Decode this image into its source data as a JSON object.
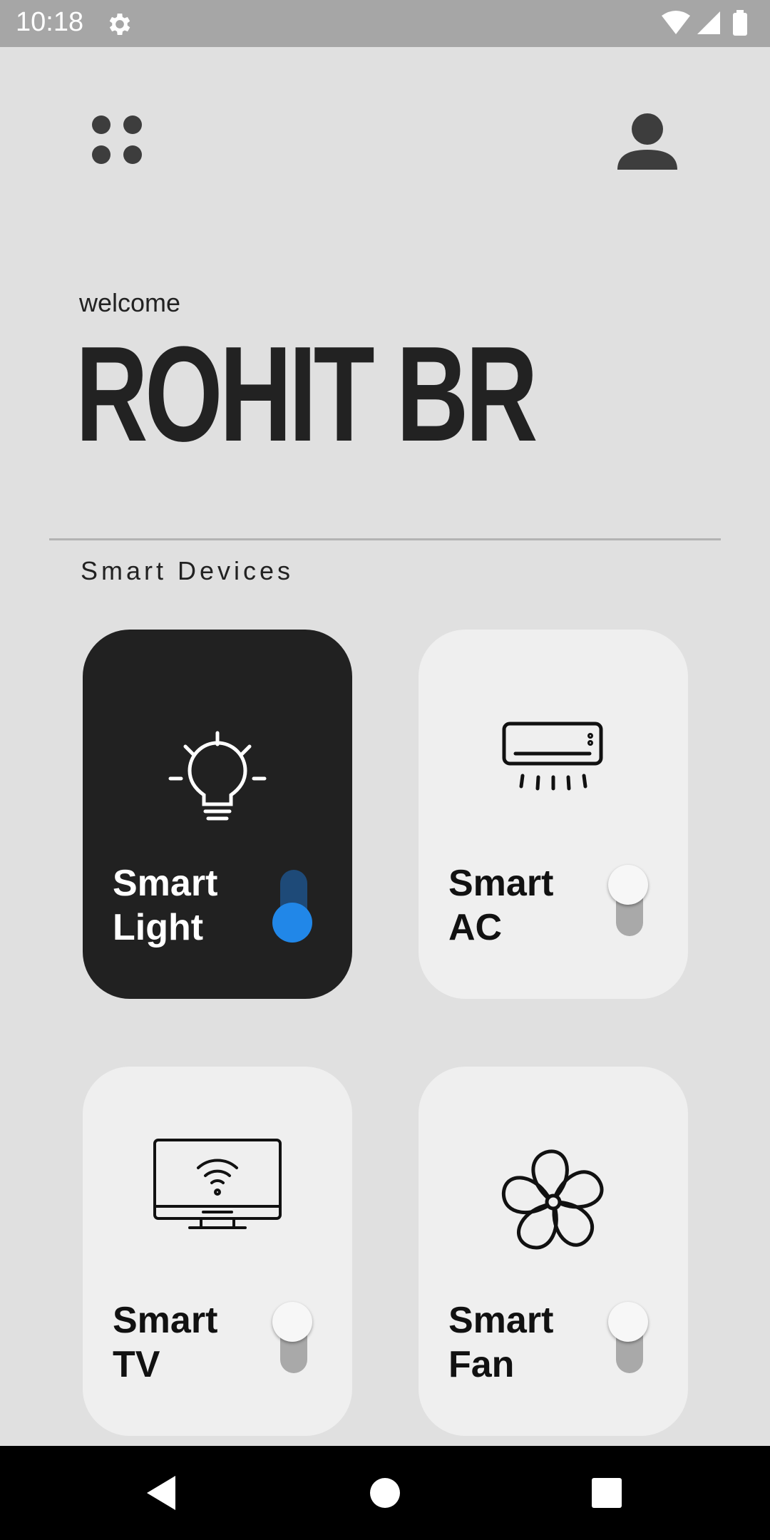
{
  "status_bar": {
    "time": "10:18",
    "icons": [
      "settings-icon",
      "wifi-icon",
      "signal-icon",
      "battery-icon"
    ]
  },
  "header": {
    "menu_icon": "grid-dots-icon",
    "profile_icon": "person-icon"
  },
  "welcome": {
    "label": "welcome",
    "name": "ROHIT BR"
  },
  "section": {
    "title": "Smart Devices"
  },
  "devices": [
    {
      "line1": "Smart",
      "line2": "Light",
      "icon": "light-bulb-icon",
      "on": true
    },
    {
      "line1": "Smart",
      "line2": "AC",
      "icon": "air-conditioner-icon",
      "on": false
    },
    {
      "line1": "Smart",
      "line2": "TV",
      "icon": "smart-tv-icon",
      "on": false
    },
    {
      "line1": "Smart",
      "line2": "Fan",
      "icon": "fan-icon",
      "on": false
    }
  ],
  "colors": {
    "background": "#e0e0e0",
    "card_on": "#212121",
    "card_off": "#efefef",
    "toggle_on": "#2187e8"
  },
  "nav_bar": {
    "buttons": [
      "back-icon",
      "home-icon",
      "recents-icon"
    ]
  }
}
